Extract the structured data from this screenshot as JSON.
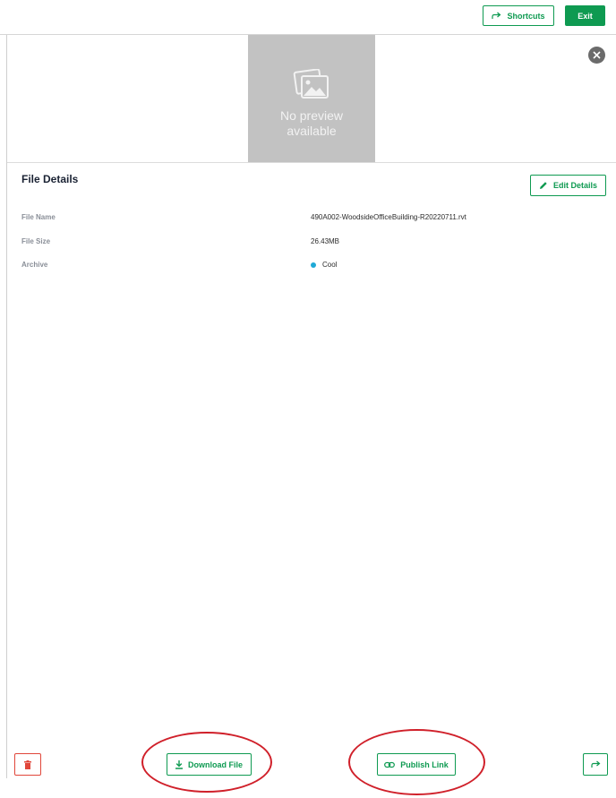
{
  "header": {
    "shortcuts_label": "Shortcuts",
    "exit_label": "Exit"
  },
  "preview": {
    "text": "No preview available"
  },
  "details": {
    "title": "File Details",
    "edit_label": "Edit Details",
    "rows": [
      {
        "label": "File Name",
        "value": "490A002-WoodsideOfficeBuilding-R20220711.rvt"
      },
      {
        "label": "File Size",
        "value": "26.43MB"
      },
      {
        "label": "Archive",
        "value": "Cool",
        "status_color": "#1fa9d6"
      }
    ]
  },
  "actions": {
    "download_label": "Download File",
    "publish_label": "Publish Link"
  },
  "colors": {
    "accent": "#0e9a51",
    "danger": "#e0463a",
    "annotation": "#d0202a"
  },
  "icons": [
    "share-icon",
    "close-icon",
    "image-icon",
    "pencil-icon",
    "trash-icon",
    "download-icon",
    "link-icon"
  ]
}
